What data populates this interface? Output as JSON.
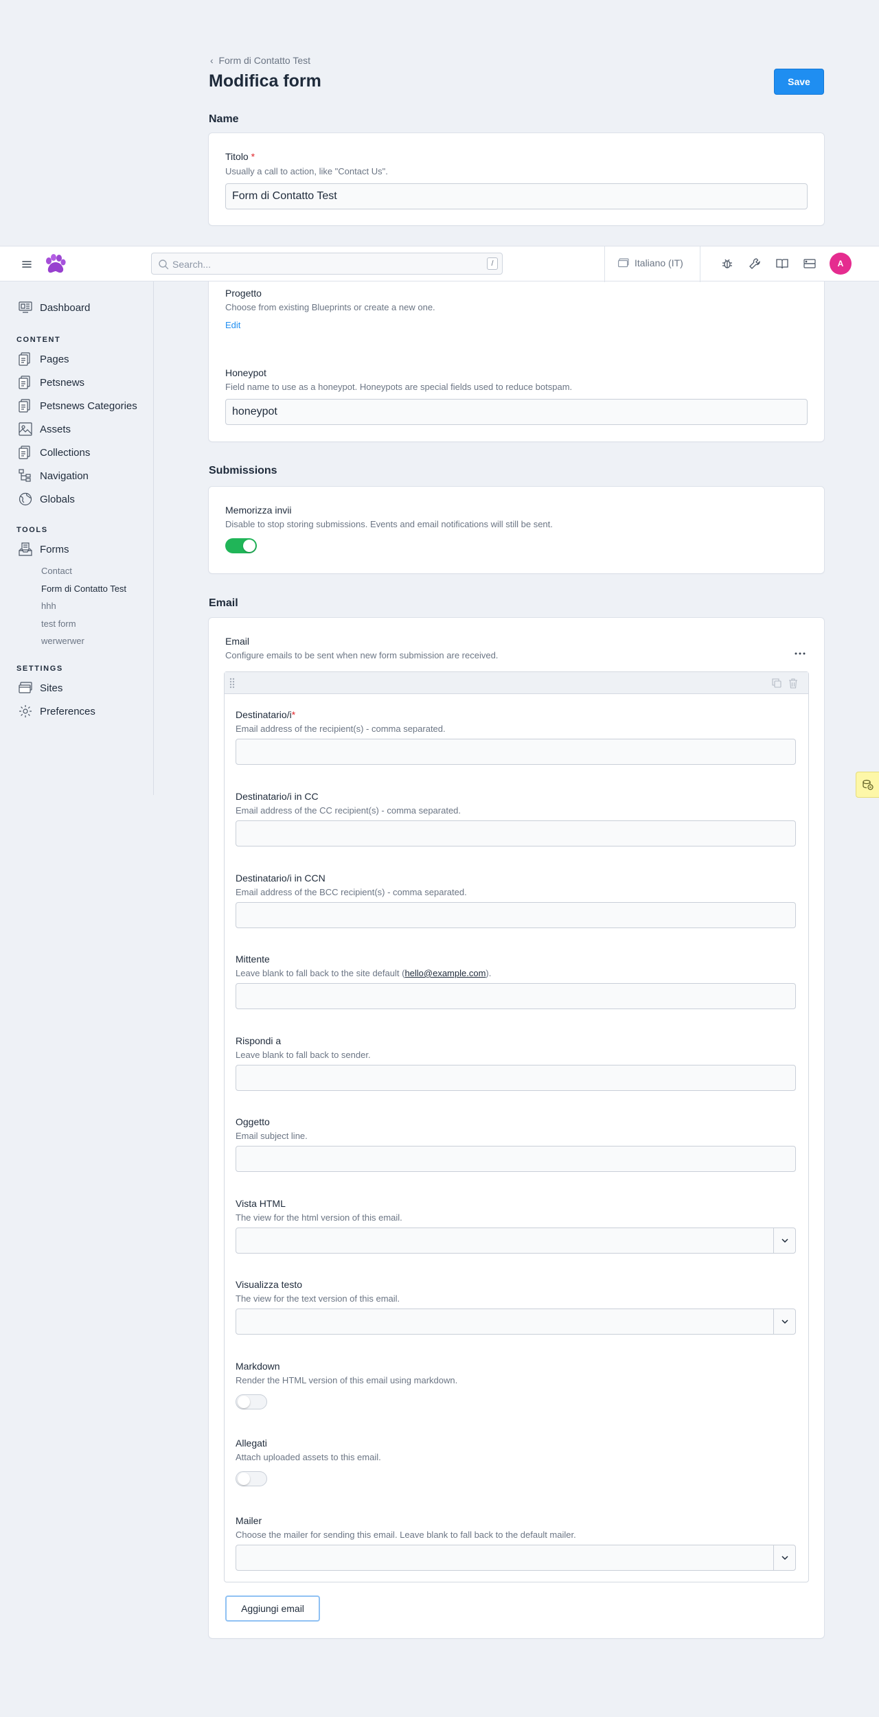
{
  "topbar": {
    "search_placeholder": "Search...",
    "search_shortcut": "/",
    "site_selector": "Italiano (IT)",
    "avatar_initial": "A"
  },
  "sidebar": {
    "dashboard": "Dashboard",
    "content_heading": "CONTENT",
    "content_items": [
      "Pages",
      "Petsnews",
      "Petsnews Categories",
      "Assets",
      "Collections",
      "Navigation",
      "Globals"
    ],
    "tools_heading": "TOOLS",
    "forms": "Forms",
    "form_items": [
      "Contact",
      "Form di Contatto Test",
      "hhh",
      "test form",
      "werwerwer"
    ],
    "settings_heading": "SETTINGS",
    "settings_items": [
      "Sites",
      "Preferences"
    ]
  },
  "header": {
    "breadcrumb": "Form di Contatto Test",
    "title": "Modifica form",
    "save_label": "Save"
  },
  "name_section": {
    "title": "Name",
    "titolo_label": "Titolo",
    "titolo_required": "*",
    "titolo_help": "Usually a call to action, like \"Contact Us\".",
    "titolo_value": "Form di Contatto Test"
  },
  "fields_section": {
    "progetto_label": "Progetto",
    "progetto_help": "Choose from existing Blueprints or create a new one.",
    "edit_link": "Edit",
    "honeypot_label": "Honeypot",
    "honeypot_help": "Field name to use as a honeypot. Honeypots are special fields used to reduce botspam.",
    "honeypot_value": "honeypot"
  },
  "submissions": {
    "title": "Submissions",
    "store_label": "Memorizza invii",
    "store_help": "Disable to stop storing submissions. Events and email notifications will still be sent.",
    "store_on": true
  },
  "email": {
    "section_title": "Email",
    "label": "Email",
    "help": "Configure emails to be sent when new form submission are received.",
    "to_label": "Destinatario/i",
    "to_required": "*",
    "to_help": "Email address of the recipient(s) - comma separated.",
    "cc_label": "Destinatario/i in CC",
    "cc_help": "Email address of the CC recipient(s) - comma separated.",
    "bcc_label": "Destinatario/i in CCN",
    "bcc_help": "Email address of the BCC recipient(s) - comma separated.",
    "from_label": "Mittente",
    "from_help_pre": "Leave blank to fall back to the site default (",
    "from_help_link": "hello@example.com",
    "from_help_post": ").",
    "reply_label": "Rispondi a",
    "reply_help": "Leave blank to fall back to sender.",
    "subject_label": "Oggetto",
    "subject_help": "Email subject line.",
    "html_label": "Vista HTML",
    "html_help": "The view for the html version of this email.",
    "text_label": "Visualizza testo",
    "text_help": "The view for the text version of this email.",
    "markdown_label": "Markdown",
    "markdown_help": "Render the HTML version of this email using markdown.",
    "attachments_label": "Allegati",
    "attachments_help": "Attach uploaded assets to this email.",
    "mailer_label": "Mailer",
    "mailer_help": "Choose the mailer for sending this email. Leave blank to fall back to the default mailer.",
    "add_label": "Aggiungi email"
  },
  "colors": {
    "accent": "#1f8ef1",
    "toggle_on": "#20b558",
    "avatar": "#e52c8f",
    "required": "#e0262b"
  }
}
